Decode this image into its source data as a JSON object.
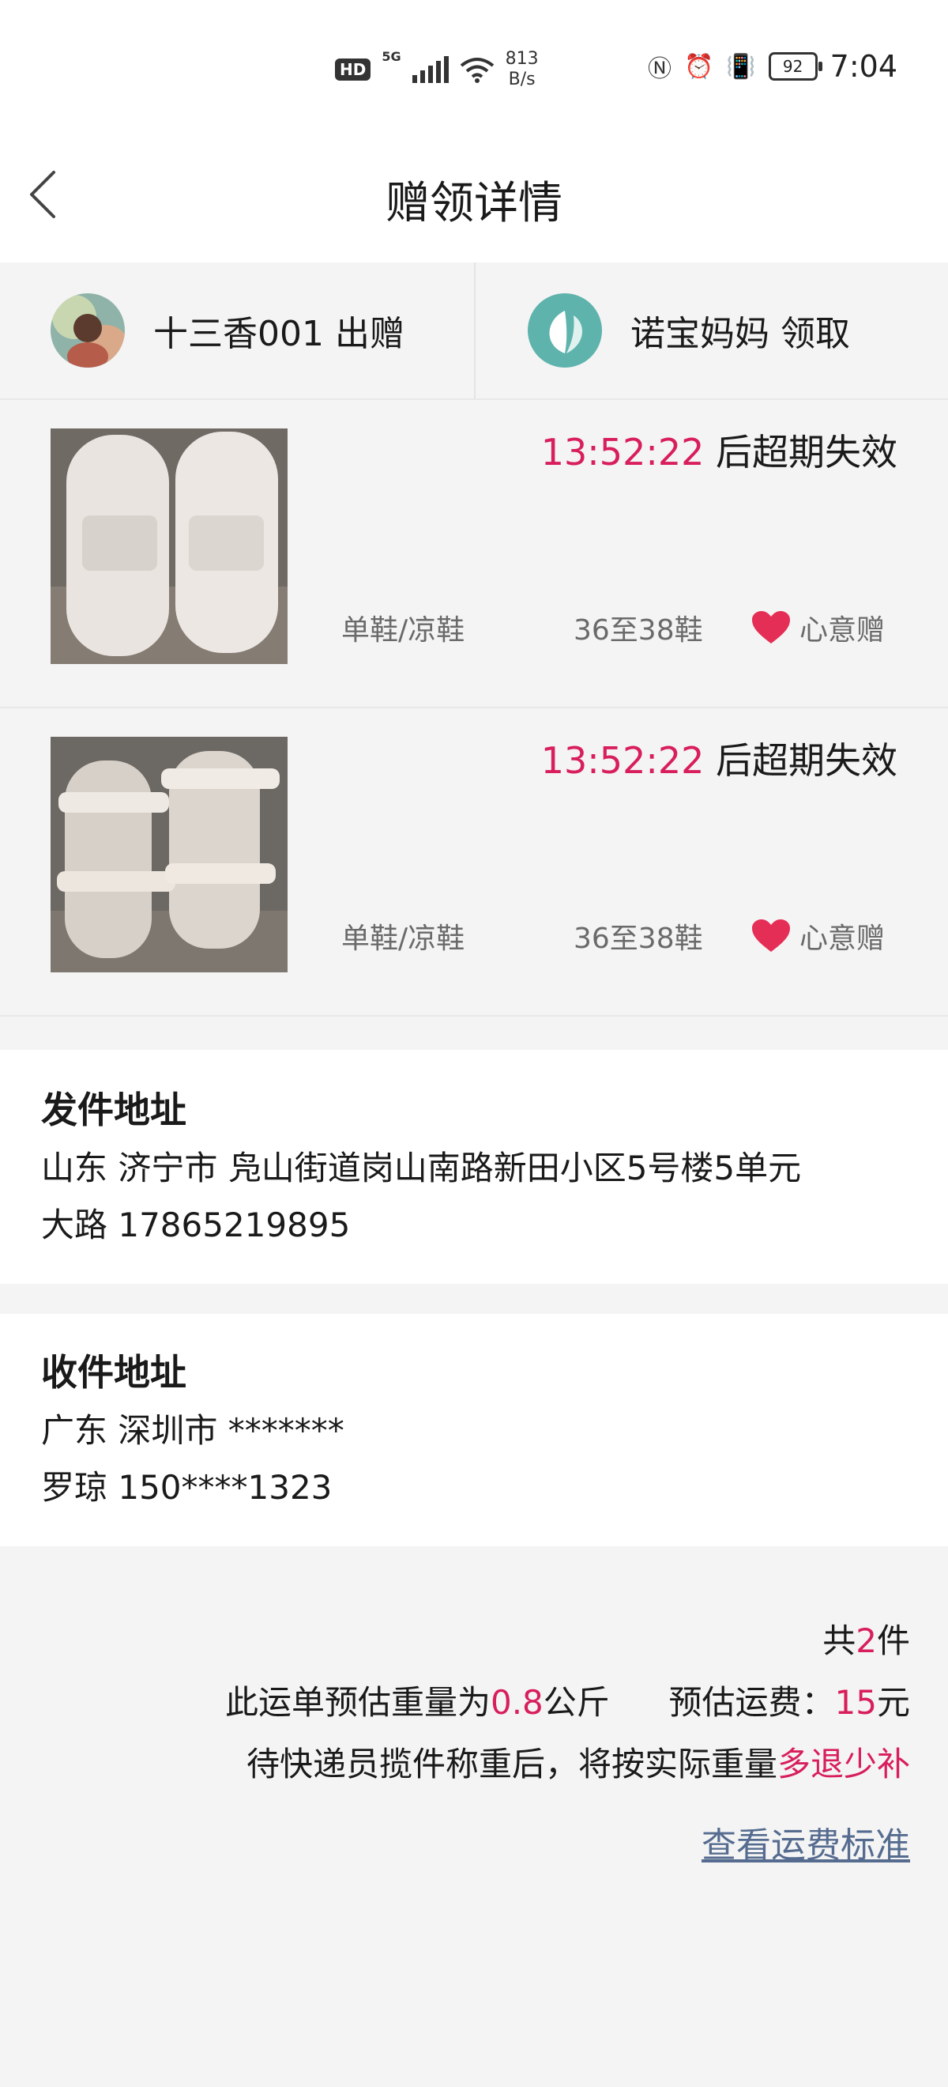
{
  "status_bar": {
    "hd": "HD",
    "network": "5G",
    "net_speed_value": "813",
    "net_speed_unit": "B/s",
    "icons": [
      "nfc-icon",
      "alarm-icon",
      "vibrate-icon"
    ],
    "battery": "92",
    "time": "7:04"
  },
  "header": {
    "title": "赠领详情",
    "back_icon": "chevron-left-icon"
  },
  "giver": {
    "text": "十三香001 出赠"
  },
  "receiver": {
    "text": "诺宝妈妈 领取"
  },
  "items": [
    {
      "countdown": "13:52:22",
      "countdown_suffix": " 后超期失效",
      "category": "单鞋/凉鞋",
      "size": "36至38鞋",
      "gift_type": "心意赠"
    },
    {
      "countdown": "13:52:22",
      "countdown_suffix": " 后超期失效",
      "category": "单鞋/凉鞋",
      "size": "36至38鞋",
      "gift_type": "心意赠"
    }
  ],
  "sender_address": {
    "label": "发件地址",
    "line1": "山东 济宁市 凫山街道岗山南路新田小区5号楼5单元",
    "line2": "大路 17865219895"
  },
  "recipient_address": {
    "label": "收件地址",
    "line1": "广东 深圳市 *******",
    "line2": "罗琼 150****1323"
  },
  "summary": {
    "count_prefix": "共",
    "count": "2",
    "count_suffix": "件",
    "weight_prefix": "此运单预估重量为",
    "weight": "0.8",
    "weight_unit": "公斤",
    "fee_label": "预估运费：",
    "fee": "15",
    "fee_unit": "元",
    "note_prefix": "待快递员揽件称重后，将按实际重量",
    "note_highlight": "多退少补"
  },
  "link": {
    "label": "查看运费标准"
  },
  "colors": {
    "accent": "#d81e5b",
    "link": "#556b8f",
    "background": "#f4f4f4"
  }
}
